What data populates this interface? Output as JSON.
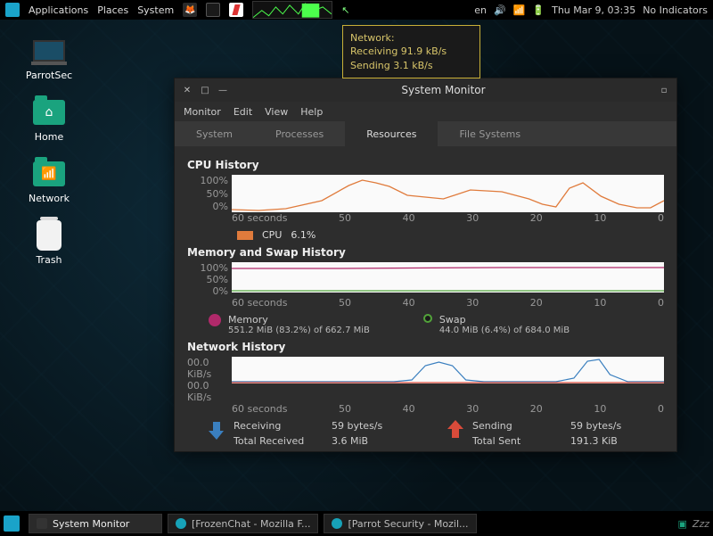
{
  "top_panel": {
    "menus": [
      "Applications",
      "Places",
      "System"
    ],
    "launchers": [
      "firefox-icon",
      "terminal-icon",
      "document-icon"
    ],
    "lang": "en",
    "datetime": "Thu Mar  9, 03:35",
    "no_indicators": "No Indicators"
  },
  "tooltip": {
    "title": "Network:",
    "line1": "Receiving 91.9 kB/s",
    "line2": "Sending 3.1 kB/s"
  },
  "desktop": {
    "icons": [
      {
        "name": "parrotsec-icon",
        "label": "ParrotSec"
      },
      {
        "name": "home-icon",
        "label": "Home"
      },
      {
        "name": "network-icon",
        "label": "Network"
      },
      {
        "name": "trash-icon",
        "label": "Trash"
      }
    ]
  },
  "window": {
    "title": "System Monitor",
    "menus": [
      "Monitor",
      "Edit",
      "View",
      "Help"
    ],
    "tabs": [
      "System",
      "Processes",
      "Resources",
      "File Systems"
    ],
    "active_tab": "Resources",
    "cpu": {
      "title": "CPU History",
      "legend_label": "CPU",
      "legend_value": "6.1%"
    },
    "mem": {
      "title": "Memory and Swap History",
      "memory_label": "Memory",
      "memory_value": "551.2 MiB (83.2%) of 662.7 MiB",
      "swap_label": "Swap",
      "swap_value": "44.0 MiB (6.4%) of 684.0 MiB"
    },
    "net": {
      "title": "Network History",
      "recv_label": "Receiving",
      "recv_rate": "59 bytes/s",
      "recv_total_label": "Total Received",
      "recv_total": "3.6 MiB",
      "send_label": "Sending",
      "send_rate": "59 bytes/s",
      "send_total_label": "Total Sent",
      "send_total": "191.3 KiB"
    },
    "yaxis_pct": [
      "100%",
      "50%",
      "0%"
    ],
    "yaxis_net": [
      "00.0 KiB/s",
      "00.0 KiB/s"
    ],
    "xaxis": [
      "60 seconds",
      "50",
      "40",
      "30",
      "20",
      "10",
      "0"
    ]
  },
  "taskbar": {
    "items": [
      {
        "label": "System Monitor",
        "active": true
      },
      {
        "label": "[FrozenChat - Mozilla F...",
        "active": false
      },
      {
        "label": "[Parrot Security - Mozil...",
        "active": false
      }
    ],
    "sleep": "Zzz"
  },
  "chart_data": [
    {
      "type": "line",
      "title": "CPU History",
      "xlabel": "seconds",
      "ylabel": "%",
      "xlim": [
        60,
        0
      ],
      "ylim": [
        0,
        100
      ],
      "x": [
        60,
        55,
        50,
        45,
        40,
        38,
        36,
        34,
        32,
        30,
        28,
        24,
        20,
        16,
        14,
        12,
        10,
        8,
        6,
        4,
        2,
        0
      ],
      "series": [
        {
          "name": "CPU",
          "color": "#e07b3c",
          "values": [
            6,
            5,
            8,
            30,
            72,
            86,
            78,
            70,
            45,
            40,
            35,
            60,
            55,
            35,
            20,
            12,
            65,
            78,
            42,
            20,
            10,
            30
          ]
        }
      ]
    },
    {
      "type": "line",
      "title": "Memory and Swap History",
      "xlabel": "seconds",
      "ylabel": "%",
      "xlim": [
        60,
        0
      ],
      "ylim": [
        0,
        100
      ],
      "x": [
        60,
        50,
        40,
        30,
        20,
        10,
        0
      ],
      "series": [
        {
          "name": "Memory",
          "color": "#b0296a",
          "values": [
            80,
            80,
            81,
            82,
            83,
            83,
            83
          ]
        },
        {
          "name": "Swap",
          "color": "#52a33a",
          "values": [
            6,
            6,
            6,
            6,
            6,
            6,
            6
          ]
        }
      ]
    },
    {
      "type": "line",
      "title": "Network History",
      "xlabel": "seconds",
      "ylabel": "KiB/s",
      "xlim": [
        60,
        0
      ],
      "ylim": [
        0,
        1
      ],
      "x": [
        60,
        55,
        50,
        45,
        40,
        35,
        33,
        31,
        29,
        27,
        25,
        20,
        15,
        12,
        10,
        8,
        6,
        4,
        2,
        0
      ],
      "series": [
        {
          "name": "Receiving",
          "color": "#3a7fbf",
          "values": [
            0,
            0,
            0,
            0,
            0,
            0.1,
            0.6,
            0.8,
            0.6,
            0.1,
            0,
            0,
            0,
            0,
            0.2,
            0.8,
            0.9,
            0.3,
            0,
            0
          ]
        },
        {
          "name": "Sending",
          "color": "#d94b3a",
          "values": [
            0,
            0,
            0,
            0,
            0,
            0,
            0,
            0,
            0,
            0,
            0,
            0,
            0,
            0,
            0,
            0,
            0,
            0,
            0,
            0
          ]
        }
      ]
    }
  ],
  "colors": {
    "cpu": "#e07b3c",
    "memory": "#b0296a",
    "swap": "#52a33a",
    "recv": "#3a7fbf",
    "send": "#d94b3a"
  }
}
